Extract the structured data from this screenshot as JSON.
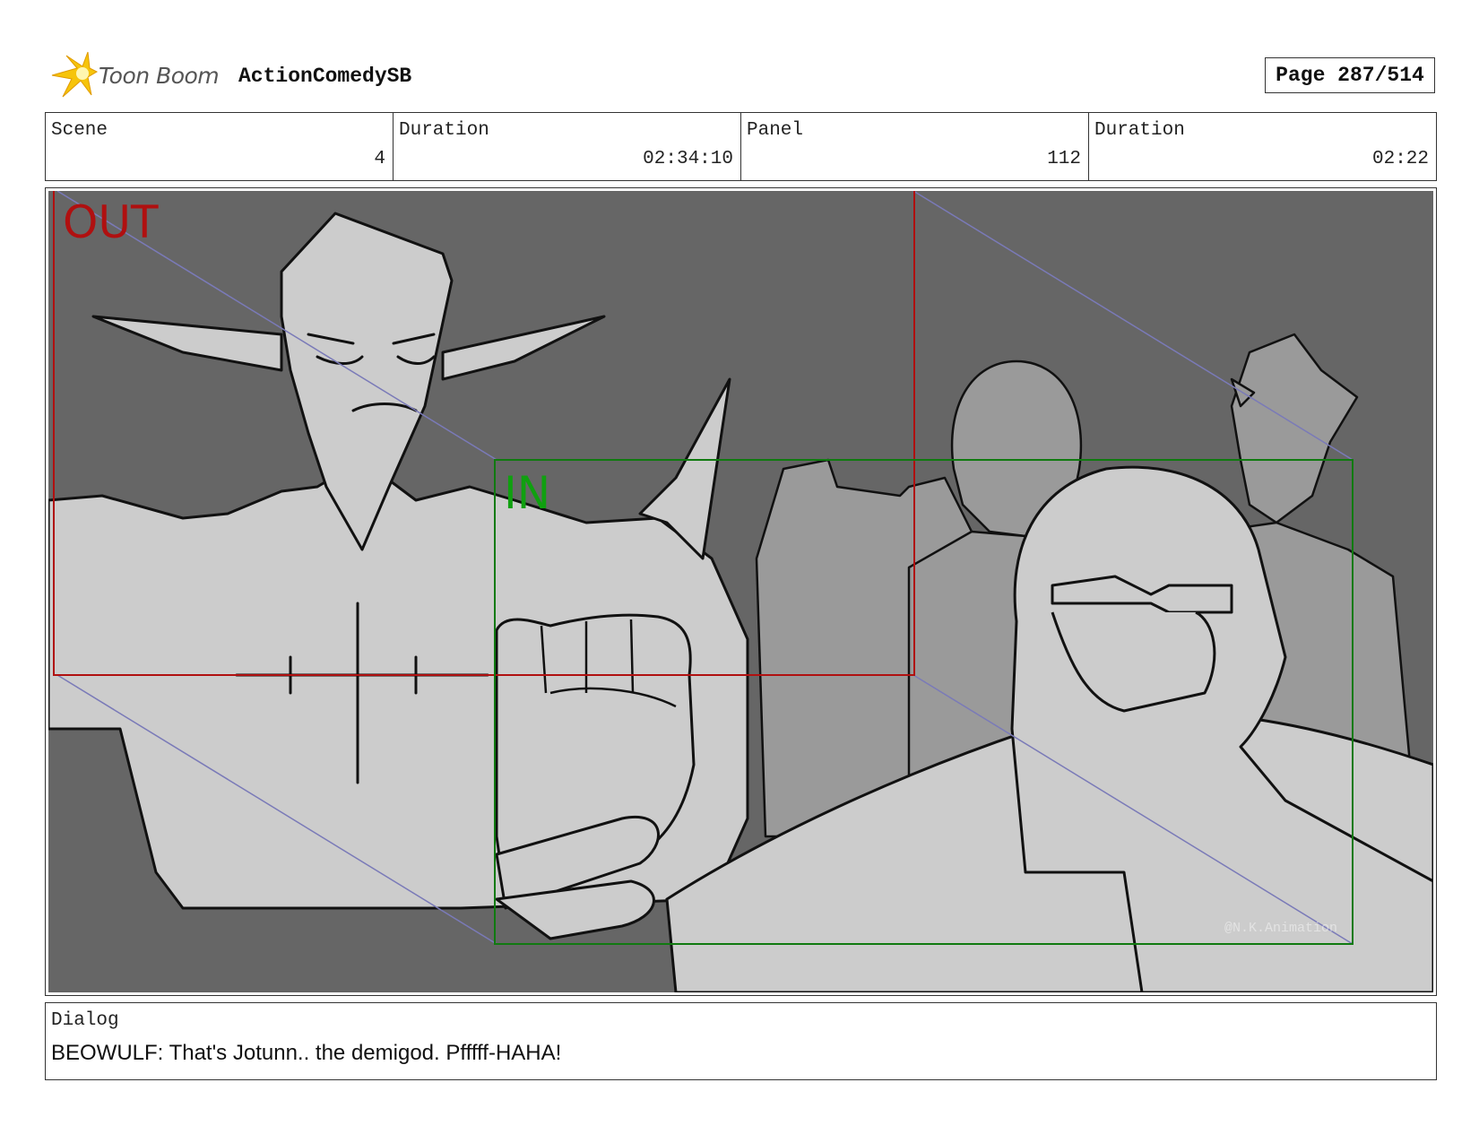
{
  "header": {
    "logo_text": "Toon Boom",
    "project_title": "ActionComedySB",
    "page_label": "Page 287/514"
  },
  "info": {
    "scene_label": "Scene",
    "scene_value": "4",
    "scene_duration_label": "Duration",
    "scene_duration_value": "02:34:10",
    "panel_label": "Panel",
    "panel_value": "112",
    "panel_duration_label": "Duration",
    "panel_duration_value": "02:22"
  },
  "panel": {
    "out_label": "OUT",
    "in_label": "IN",
    "watermark": "@N.K.Animation",
    "colors": {
      "background": "#666666",
      "figure_fill": "#cccccc",
      "out_frame": "#b01010",
      "in_frame": "#107a10",
      "guide_lines": "#7a7ab8"
    }
  },
  "dialog": {
    "label": "Dialog",
    "text": "BEOWULF: That's Jotunn.. the demigod. Pfffff-HAHA!"
  }
}
